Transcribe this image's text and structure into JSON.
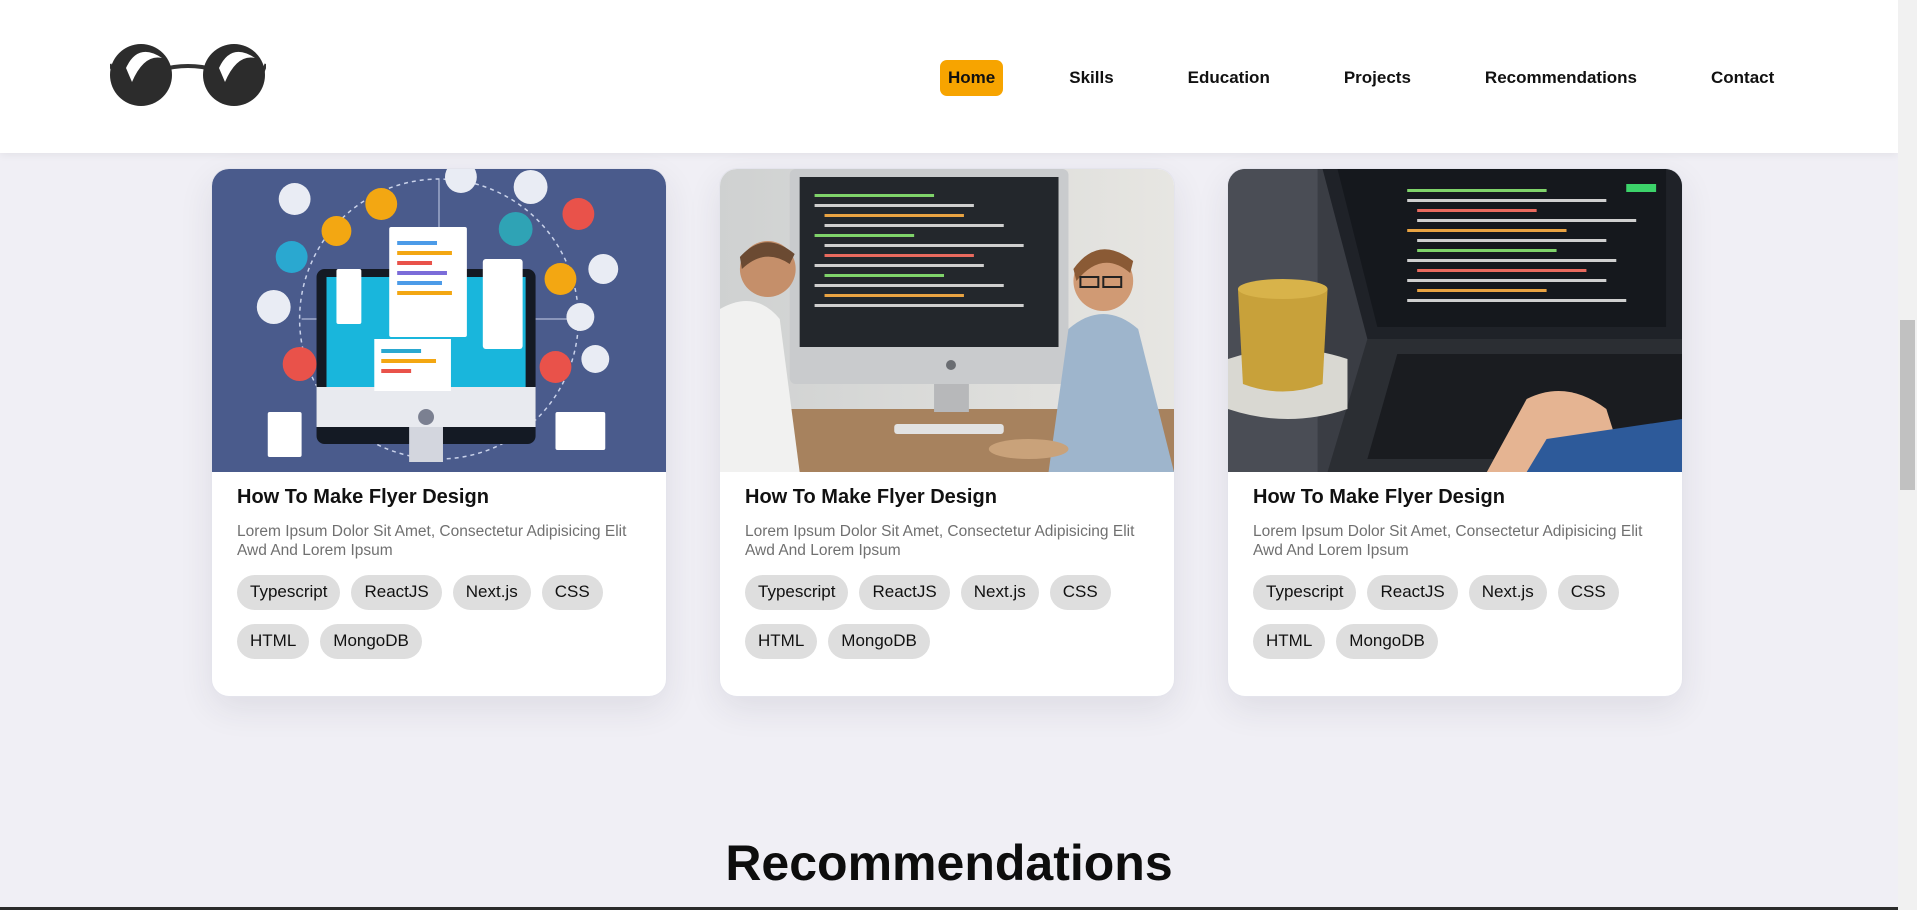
{
  "nav": {
    "items": [
      {
        "label": "Home",
        "active": true
      },
      {
        "label": "Skills",
        "active": false
      },
      {
        "label": "Education",
        "active": false
      },
      {
        "label": "Projects",
        "active": false
      },
      {
        "label": "Recommendations",
        "active": false
      },
      {
        "label": "Contact",
        "active": false
      }
    ]
  },
  "logo": {
    "icon": "glasses-logo-icon"
  },
  "projects": [
    {
      "title": "How To Make Flyer Design",
      "description": "Lorem Ipsum Dolor Sit Amet, Consectetur Adipisicing Elit Awd And Lorem Ipsum",
      "tags": [
        "Typescript",
        "ReactJS",
        "Next.js",
        "CSS",
        "HTML",
        "MongoDB"
      ],
      "image": "web-development-illustration"
    },
    {
      "title": "How To Make Flyer Design",
      "description": "Lorem Ipsum Dolor Sit Amet, Consectetur Adipisicing Elit Awd And Lorem Ipsum",
      "tags": [
        "Typescript",
        "ReactJS",
        "Next.js",
        "CSS",
        "HTML",
        "MongoDB"
      ],
      "image": "two-developers-at-computer-photo"
    },
    {
      "title": "How To Make Flyer Design",
      "description": "Lorem Ipsum Dolor Sit Amet, Consectetur Adipisicing Elit Awd And Lorem Ipsum",
      "tags": [
        "Typescript",
        "ReactJS",
        "Next.js",
        "CSS",
        "HTML",
        "MongoDB"
      ],
      "image": "laptop-code-with-coffee-photo"
    }
  ],
  "recommendations": {
    "heading": "Recommendations"
  },
  "colors": {
    "accent": "#f7a400",
    "background": "#f0eff5",
    "tag_bg": "#dedede"
  }
}
